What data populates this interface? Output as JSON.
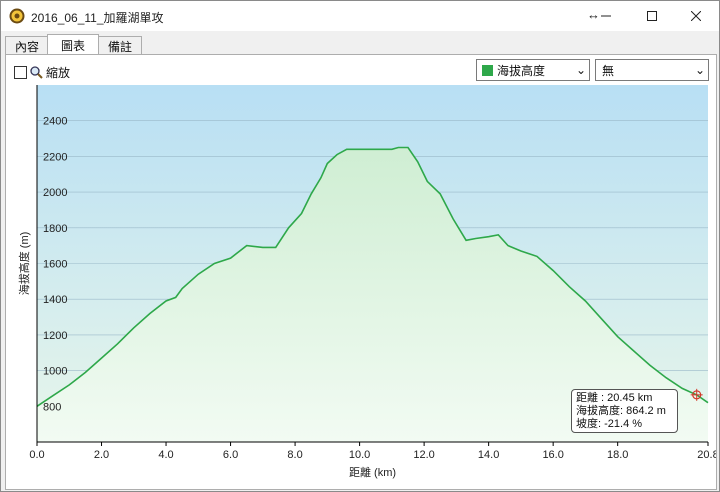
{
  "window": {
    "title": "2016_06_11_加羅湖單攻",
    "resize_glyph": "↔"
  },
  "tabs": [
    {
      "label": "內容"
    },
    {
      "label": "圖表"
    },
    {
      "label": "備註"
    }
  ],
  "toolbar": {
    "zoom_label": "縮放",
    "zoom_checked": false,
    "series_select": "海拔高度",
    "second_select": "無"
  },
  "colors": {
    "line": "#2ea84a",
    "sky_top": "#b8dff4",
    "sky_bottom": "#e8f6ea",
    "tooltip_border": "#555555",
    "marker": "#d23a2a"
  },
  "icons": [
    "app-logo-icon",
    "restore-arrow-icon",
    "minimize-icon",
    "maximize-icon",
    "close-icon",
    "magnifier-icon",
    "chevron-down-icon",
    "crosshair-marker-icon"
  ],
  "tooltip": {
    "distance": "距離  : 20.45 km",
    "elevation": "海拔高度: 864.2 m",
    "slope": "坡度: -21.4 %"
  },
  "chart_data": {
    "type": "area",
    "xlabel": "距離 (km)",
    "ylabel": "海拔高度 (m)",
    "xlim": [
      0,
      20.8
    ],
    "ylim": [
      600,
      2600
    ],
    "xticks": [
      0.0,
      2.0,
      4.0,
      6.0,
      8.0,
      10.0,
      12.0,
      14.0,
      16.0,
      18.0,
      20.8
    ],
    "xtick_labels": [
      "0.0",
      "2.0",
      "4.0",
      "6.0",
      "8.0",
      "10.0",
      "12.0",
      "14.0",
      "16.0",
      "18.0",
      "20.8"
    ],
    "yticks": [
      800,
      1000,
      1200,
      1400,
      1600,
      1800,
      2000,
      2200,
      2400
    ],
    "grid": true,
    "series": [
      {
        "x": [
          0.0,
          0.5,
          1.0,
          1.5,
          2.0,
          2.5,
          3.0,
          3.5,
          4.0,
          4.3,
          4.5,
          5.0,
          5.5,
          6.0,
          6.5,
          7.0,
          7.4,
          7.8,
          8.2,
          8.5,
          8.8,
          9.0,
          9.3,
          9.6,
          10.0,
          10.5,
          11.0,
          11.2,
          11.5,
          11.8,
          12.1,
          12.5,
          12.9,
          13.3,
          13.6,
          14.0,
          14.3,
          14.6,
          15.0,
          15.5,
          16.0,
          16.5,
          17.0,
          17.5,
          18.0,
          18.5,
          19.0,
          19.5,
          20.0,
          20.45,
          20.8
        ],
        "y": [
          800,
          860,
          920,
          990,
          1070,
          1150,
          1240,
          1320,
          1390,
          1410,
          1460,
          1540,
          1600,
          1630,
          1700,
          1690,
          1690,
          1800,
          1880,
          1990,
          2080,
          2160,
          2210,
          2240,
          2240,
          2240,
          2240,
          2250,
          2250,
          2170,
          2060,
          1990,
          1850,
          1730,
          1740,
          1750,
          1760,
          1700,
          1670,
          1640,
          1560,
          1470,
          1390,
          1290,
          1190,
          1110,
          1030,
          960,
          900,
          864,
          820
        ]
      }
    ]
  }
}
